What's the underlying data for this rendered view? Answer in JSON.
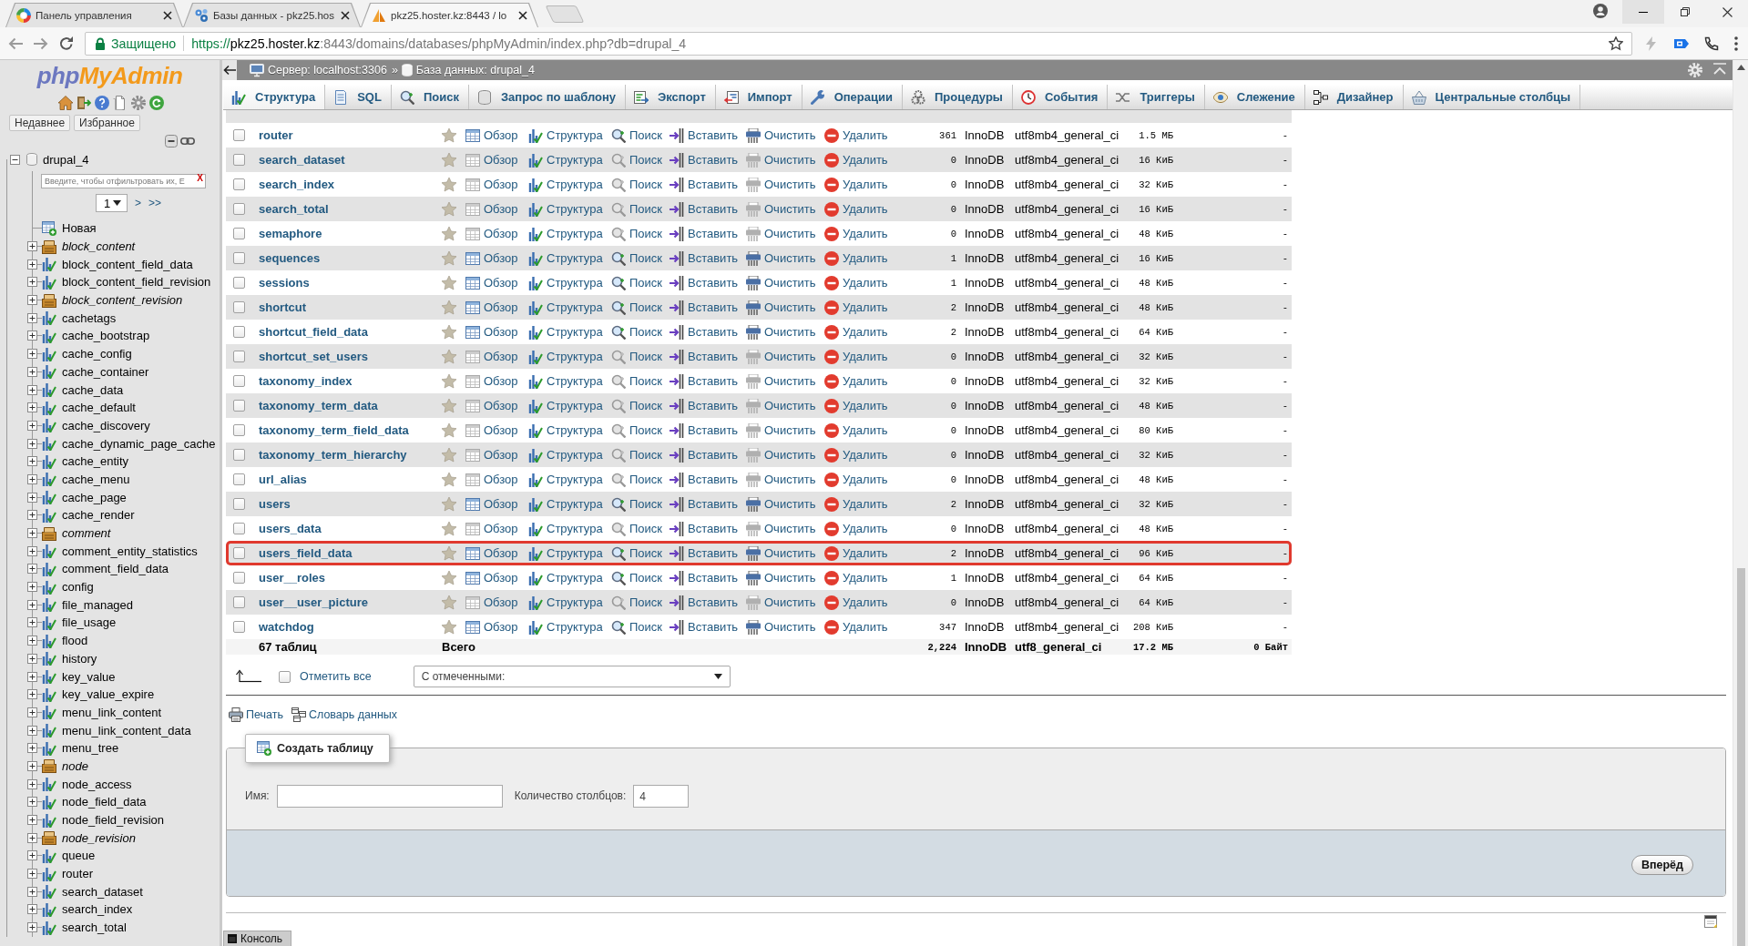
{
  "browser": {
    "tabs": [
      {
        "title": "Панель управления",
        "selected": false
      },
      {
        "title": "Базы данных - pkz25.hos",
        "selected": false
      },
      {
        "title": "pkz25.hoster.kz:8443 / lo",
        "selected": true
      }
    ],
    "address": {
      "security": "Защищено",
      "scheme": "https://",
      "host": "pkz25.hoster.kz",
      "path": ":8443/domains/databases/phpMyAdmin/index.php?db=drupal_4"
    }
  },
  "sidebar": {
    "logo": [
      "php",
      "MyAdmin"
    ],
    "buttons": [
      "Недавнее",
      "Избранное"
    ],
    "database": {
      "name": "drupal_4",
      "expanded": true
    },
    "filter": {
      "placeholder": "Введите, чтобы отфильтровать их, E",
      "clear": "X"
    },
    "pager": {
      "page": "1",
      "next": ">",
      "last": ">>"
    },
    "new_item": "Новая",
    "tables": [
      {
        "name": "block_content",
        "kind": "view",
        "expanded": false
      },
      {
        "name": "block_content_field_data",
        "kind": "table",
        "expanded": false
      },
      {
        "name": "block_content_field_revision",
        "kind": "table",
        "expanded": false
      },
      {
        "name": "block_content_revision",
        "kind": "view",
        "expanded": false
      },
      {
        "name": "cachetags",
        "kind": "table",
        "expanded": false
      },
      {
        "name": "cache_bootstrap",
        "kind": "table",
        "expanded": false
      },
      {
        "name": "cache_config",
        "kind": "table",
        "expanded": false
      },
      {
        "name": "cache_container",
        "kind": "table",
        "expanded": false
      },
      {
        "name": "cache_data",
        "kind": "table",
        "expanded": false
      },
      {
        "name": "cache_default",
        "kind": "table",
        "expanded": false
      },
      {
        "name": "cache_discovery",
        "kind": "table",
        "expanded": false
      },
      {
        "name": "cache_dynamic_page_cache",
        "kind": "table",
        "expanded": false
      },
      {
        "name": "cache_entity",
        "kind": "table",
        "expanded": false
      },
      {
        "name": "cache_menu",
        "kind": "table",
        "expanded": false
      },
      {
        "name": "cache_page",
        "kind": "table",
        "expanded": false
      },
      {
        "name": "cache_render",
        "kind": "table",
        "expanded": false
      },
      {
        "name": "comment",
        "kind": "view",
        "expanded": false
      },
      {
        "name": "comment_entity_statistics",
        "kind": "table",
        "expanded": false
      },
      {
        "name": "comment_field_data",
        "kind": "table",
        "expanded": false
      },
      {
        "name": "config",
        "kind": "table",
        "expanded": false
      },
      {
        "name": "file_managed",
        "kind": "table",
        "expanded": false
      },
      {
        "name": "file_usage",
        "kind": "table",
        "expanded": false
      },
      {
        "name": "flood",
        "kind": "table",
        "expanded": false
      },
      {
        "name": "history",
        "kind": "table",
        "expanded": false
      },
      {
        "name": "key_value",
        "kind": "table",
        "expanded": false
      },
      {
        "name": "key_value_expire",
        "kind": "table",
        "expanded": false
      },
      {
        "name": "menu_link_content",
        "kind": "table",
        "expanded": false
      },
      {
        "name": "menu_link_content_data",
        "kind": "table",
        "expanded": false
      },
      {
        "name": "menu_tree",
        "kind": "table",
        "expanded": false
      },
      {
        "name": "node",
        "kind": "view",
        "expanded": false
      },
      {
        "name": "node_access",
        "kind": "table",
        "expanded": false
      },
      {
        "name": "node_field_data",
        "kind": "table",
        "expanded": false
      },
      {
        "name": "node_field_revision",
        "kind": "table",
        "expanded": false
      },
      {
        "name": "node_revision",
        "kind": "view",
        "expanded": false
      },
      {
        "name": "queue",
        "kind": "table",
        "expanded": false
      },
      {
        "name": "router",
        "kind": "table",
        "expanded": false
      },
      {
        "name": "search_dataset",
        "kind": "table",
        "expanded": false
      },
      {
        "name": "search_index",
        "kind": "table",
        "expanded": false
      },
      {
        "name": "search_total",
        "kind": "table",
        "expanded": false
      }
    ]
  },
  "breadcrumb": {
    "items": [
      "Сервер: localhost:3306",
      "База данных: drupal_4"
    ],
    "separator": "»"
  },
  "menu": [
    {
      "label": "Структура",
      "selected": true
    },
    {
      "label": "SQL",
      "selected": false
    },
    {
      "label": "Поиск",
      "selected": false
    },
    {
      "label": "Запрос по шаблону",
      "selected": false
    },
    {
      "label": "Экспорт",
      "selected": false
    },
    {
      "label": "Импорт",
      "selected": false
    },
    {
      "label": "Операции",
      "selected": false
    },
    {
      "label": "Процедуры",
      "selected": false
    },
    {
      "label": "События",
      "selected": false
    },
    {
      "label": "Триггеры",
      "selected": false
    },
    {
      "label": "Слежение",
      "selected": false
    },
    {
      "label": "Дизайнер",
      "selected": false
    },
    {
      "label": "Центральные столбцы",
      "selected": false
    }
  ],
  "table": {
    "rows": [
      {
        "name": "router",
        "checked": false,
        "empty": false,
        "highlighted": false,
        "actions": [
          "Обзор",
          "Структура",
          "Поиск",
          "Вставить",
          "Очистить",
          "Удалить"
        ],
        "records": "361",
        "engine": "InnoDB",
        "collation": "utf8mb4_general_ci",
        "size": "1.5 МБ",
        "overhead": "-"
      },
      {
        "name": "search_dataset",
        "checked": false,
        "empty": true,
        "highlighted": false,
        "actions": [
          "Обзор",
          "Структура",
          "Поиск",
          "Вставить",
          "Очистить",
          "Удалить"
        ],
        "records": "0",
        "engine": "InnoDB",
        "collation": "utf8mb4_general_ci",
        "size": "16 КиБ",
        "overhead": "-"
      },
      {
        "name": "search_index",
        "checked": false,
        "empty": true,
        "highlighted": false,
        "actions": [
          "Обзор",
          "Структура",
          "Поиск",
          "Вставить",
          "Очистить",
          "Удалить"
        ],
        "records": "0",
        "engine": "InnoDB",
        "collation": "utf8mb4_general_ci",
        "size": "32 КиБ",
        "overhead": "-"
      },
      {
        "name": "search_total",
        "checked": false,
        "empty": true,
        "highlighted": false,
        "actions": [
          "Обзор",
          "Структура",
          "Поиск",
          "Вставить",
          "Очистить",
          "Удалить"
        ],
        "records": "0",
        "engine": "InnoDB",
        "collation": "utf8mb4_general_ci",
        "size": "16 КиБ",
        "overhead": "-"
      },
      {
        "name": "semaphore",
        "checked": false,
        "empty": true,
        "highlighted": false,
        "actions": [
          "Обзор",
          "Структура",
          "Поиск",
          "Вставить",
          "Очистить",
          "Удалить"
        ],
        "records": "0",
        "engine": "InnoDB",
        "collation": "utf8mb4_general_ci",
        "size": "48 КиБ",
        "overhead": "-"
      },
      {
        "name": "sequences",
        "checked": false,
        "empty": false,
        "highlighted": false,
        "actions": [
          "Обзор",
          "Структура",
          "Поиск",
          "Вставить",
          "Очистить",
          "Удалить"
        ],
        "records": "1",
        "engine": "InnoDB",
        "collation": "utf8mb4_general_ci",
        "size": "16 КиБ",
        "overhead": "-"
      },
      {
        "name": "sessions",
        "checked": false,
        "empty": false,
        "highlighted": false,
        "actions": [
          "Обзор",
          "Структура",
          "Поиск",
          "Вставить",
          "Очистить",
          "Удалить"
        ],
        "records": "1",
        "engine": "InnoDB",
        "collation": "utf8mb4_general_ci",
        "size": "48 КиБ",
        "overhead": "-"
      },
      {
        "name": "shortcut",
        "checked": false,
        "empty": false,
        "highlighted": false,
        "actions": [
          "Обзор",
          "Структура",
          "Поиск",
          "Вставить",
          "Очистить",
          "Удалить"
        ],
        "records": "2",
        "engine": "InnoDB",
        "collation": "utf8mb4_general_ci",
        "size": "48 КиБ",
        "overhead": "-"
      },
      {
        "name": "shortcut_field_data",
        "checked": false,
        "empty": false,
        "highlighted": false,
        "actions": [
          "Обзор",
          "Структура",
          "Поиск",
          "Вставить",
          "Очистить",
          "Удалить"
        ],
        "records": "2",
        "engine": "InnoDB",
        "collation": "utf8mb4_general_ci",
        "size": "64 КиБ",
        "overhead": "-"
      },
      {
        "name": "shortcut_set_users",
        "checked": false,
        "empty": true,
        "highlighted": false,
        "actions": [
          "Обзор",
          "Структура",
          "Поиск",
          "Вставить",
          "Очистить",
          "Удалить"
        ],
        "records": "0",
        "engine": "InnoDB",
        "collation": "utf8mb4_general_ci",
        "size": "32 КиБ",
        "overhead": "-"
      },
      {
        "name": "taxonomy_index",
        "checked": false,
        "empty": true,
        "highlighted": false,
        "actions": [
          "Обзор",
          "Структура",
          "Поиск",
          "Вставить",
          "Очистить",
          "Удалить"
        ],
        "records": "0",
        "engine": "InnoDB",
        "collation": "utf8mb4_general_ci",
        "size": "32 КиБ",
        "overhead": "-"
      },
      {
        "name": "taxonomy_term_data",
        "checked": false,
        "empty": true,
        "highlighted": false,
        "actions": [
          "Обзор",
          "Структура",
          "Поиск",
          "Вставить",
          "Очистить",
          "Удалить"
        ],
        "records": "0",
        "engine": "InnoDB",
        "collation": "utf8mb4_general_ci",
        "size": "48 КиБ",
        "overhead": "-"
      },
      {
        "name": "taxonomy_term_field_data",
        "checked": false,
        "empty": true,
        "highlighted": false,
        "actions": [
          "Обзор",
          "Структура",
          "Поиск",
          "Вставить",
          "Очистить",
          "Удалить"
        ],
        "records": "0",
        "engine": "InnoDB",
        "collation": "utf8mb4_general_ci",
        "size": "80 КиБ",
        "overhead": "-"
      },
      {
        "name": "taxonomy_term_hierarchy",
        "checked": false,
        "empty": true,
        "highlighted": false,
        "actions": [
          "Обзор",
          "Структура",
          "Поиск",
          "Вставить",
          "Очистить",
          "Удалить"
        ],
        "records": "0",
        "engine": "InnoDB",
        "collation": "utf8mb4_general_ci",
        "size": "32 КиБ",
        "overhead": "-"
      },
      {
        "name": "url_alias",
        "checked": false,
        "empty": true,
        "highlighted": false,
        "actions": [
          "Обзор",
          "Структура",
          "Поиск",
          "Вставить",
          "Очистить",
          "Удалить"
        ],
        "records": "0",
        "engine": "InnoDB",
        "collation": "utf8mb4_general_ci",
        "size": "48 КиБ",
        "overhead": "-"
      },
      {
        "name": "users",
        "checked": false,
        "empty": false,
        "highlighted": false,
        "actions": [
          "Обзор",
          "Структура",
          "Поиск",
          "Вставить",
          "Очистить",
          "Удалить"
        ],
        "records": "2",
        "engine": "InnoDB",
        "collation": "utf8mb4_general_ci",
        "size": "32 КиБ",
        "overhead": "-"
      },
      {
        "name": "users_data",
        "checked": false,
        "empty": true,
        "highlighted": false,
        "actions": [
          "Обзор",
          "Структура",
          "Поиск",
          "Вставить",
          "Очистить",
          "Удалить"
        ],
        "records": "0",
        "engine": "InnoDB",
        "collation": "utf8mb4_general_ci",
        "size": "48 КиБ",
        "overhead": "-"
      },
      {
        "name": "users_field_data",
        "checked": false,
        "empty": false,
        "highlighted": true,
        "actions": [
          "Обзор",
          "Структура",
          "Поиск",
          "Вставить",
          "Очистить",
          "Удалить"
        ],
        "records": "2",
        "engine": "InnoDB",
        "collation": "utf8mb4_general_ci",
        "size": "96 КиБ",
        "overhead": "-"
      },
      {
        "name": "user__roles",
        "checked": false,
        "empty": false,
        "highlighted": false,
        "actions": [
          "Обзор",
          "Структура",
          "Поиск",
          "Вставить",
          "Очистить",
          "Удалить"
        ],
        "records": "1",
        "engine": "InnoDB",
        "collation": "utf8mb4_general_ci",
        "size": "64 КиБ",
        "overhead": "-"
      },
      {
        "name": "user__user_picture",
        "checked": false,
        "empty": true,
        "highlighted": false,
        "actions": [
          "Обзор",
          "Структура",
          "Поиск",
          "Вставить",
          "Очистить",
          "Удалить"
        ],
        "records": "0",
        "engine": "InnoDB",
        "collation": "utf8mb4_general_ci",
        "size": "64 КиБ",
        "overhead": "-"
      },
      {
        "name": "watchdog",
        "checked": false,
        "empty": false,
        "highlighted": false,
        "actions": [
          "Обзор",
          "Структура",
          "Поиск",
          "Вставить",
          "Очистить",
          "Удалить"
        ],
        "records": "347",
        "engine": "InnoDB",
        "collation": "utf8mb4_general_ci",
        "size": "208 КиБ",
        "overhead": "-"
      }
    ],
    "totals": {
      "count": "67 таблиц",
      "label": "Всего",
      "records": "2,224",
      "engine": "InnoDB",
      "collation": "utf8_general_ci",
      "size": "17.2 МБ",
      "overhead": "0 Байт"
    }
  },
  "bulk": {
    "check_all": {
      "label": "Отметить все",
      "checked": false
    },
    "with_selected": "С отмеченными:"
  },
  "links": [
    "Печать",
    "Словарь данных"
  ],
  "create_table": {
    "legend": "Создать таблицу",
    "name_label": "Имя:",
    "columns_label": "Количество столбцов:",
    "columns_value": "4",
    "submit": "Вперёд"
  },
  "console": "Консоль"
}
